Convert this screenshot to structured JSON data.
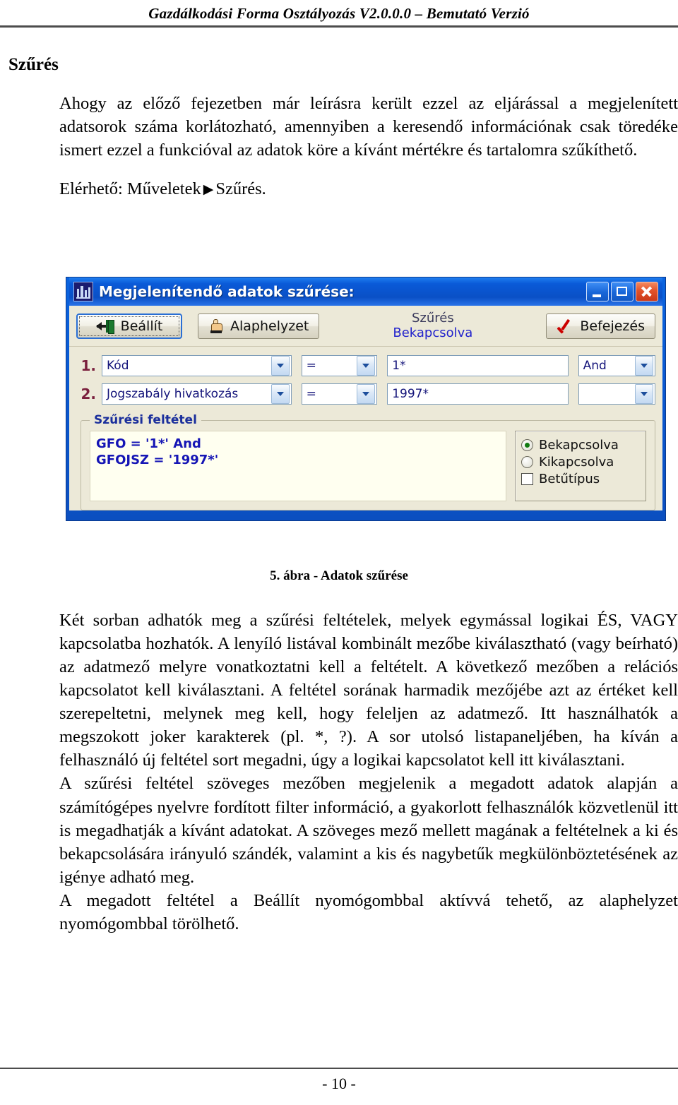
{
  "header": {
    "running_title": "Gazdálkodási Forma Osztályozás V2.0.0.0 – Bemutató Verzió"
  },
  "section": {
    "title": "Szűrés"
  },
  "intro": {
    "paragraph": "Ahogy az előző fejezetben már leírásra került ezzel az eljárással a megjelenített adatsorok száma korlátozható, amennyiben a keresendő információnak csak töredéke ismert ezzel a funkcióval az adatok köre a kívánt mértékre és tartalomra szűkíthető.",
    "access_prefix": "Elérhető: Műveletek",
    "access_arrow": "▶",
    "access_suffix": "Szűrés."
  },
  "dialog": {
    "title": "Megjelenítendő adatok szűrése:",
    "icon": "app-icon",
    "window_buttons": {
      "minimize": "minimize-icon",
      "maximize": "maximize-icon",
      "close": "close-icon"
    },
    "toolbar": {
      "setup_label": "Beállít",
      "reset_label": "Alaphelyzet",
      "finish_label": "Befejezés",
      "status_line1": "Szűrés",
      "status_line2": "Bekapcsolva"
    },
    "rows": [
      {
        "number": "1.",
        "field": "Kód",
        "operator": "=",
        "value": "1*",
        "logic": "And"
      },
      {
        "number": "2.",
        "field": "Jogszabály hivatkozás",
        "operator": "=",
        "value": "1997*",
        "logic": ""
      }
    ],
    "groupbox": {
      "legend": "Szűrési feltétel",
      "filter_line1": "GFO = '1*' And",
      "filter_line2": "GFOJSZ = '1997*'",
      "options": {
        "enabled_label": "Bekapcsolva",
        "disabled_label": "Kikapcsolva",
        "font_label": "Betűtípus",
        "enabled_selected": true,
        "disabled_selected": false,
        "font_checked": false
      }
    }
  },
  "figure": {
    "caption": "5. ábra - Adatok szűrése"
  },
  "body": {
    "p1": "Két sorban adhatók meg a szűrési feltételek, melyek egymással logikai ÉS, VAGY kapcsolatba hozhatók. A lenyíló listával kombinált mezőbe kiválasztható (vagy beírható) az adatmező melyre vonatkoztatni kell a feltételt. A következő mezőben a relációs kapcsolatot kell kiválasztani. A feltétel sorának harmadik mezőjébe azt az értéket kell szerepeltetni, melynek meg kell, hogy feleljen az adatmező. Itt használhatók a megszokott joker karakterek (pl. *, ?). A sor utolsó listapaneljében, ha kíván a felhasználó új feltétel sort megadni, úgy a logikai kapcsolatot kell itt kiválasztani.",
    "p2": "A szűrési feltétel szöveges mezőben megjelenik a megadott adatok alapján a számítógépes nyelvre fordított filter információ, a gyakorlott felhasználók közvetlenül itt is megadhatják a kívánt adatokat. A szöveges mező mellett magának a feltételnek a ki és bekapcsolására irányuló szándék, valamint a kis és nagybetűk megkülönböztetésének az igénye adható meg.",
    "p3": "A megadott feltétel a Beállít nyomógombbal aktívvá tehető, az alaphelyzet nyomógombbal törölhető."
  },
  "footer": {
    "page_number": "- 10 -"
  },
  "colors": {
    "title_bar_blue": "#0a5ad8",
    "dialog_face": "#ece9d8",
    "filter_text_blue": "#1515b5",
    "filter_bg": "#fffff0",
    "row_number": "#7a1f3d",
    "radio_dot_green": "#117a11",
    "close_button_red": "#c9391a"
  }
}
